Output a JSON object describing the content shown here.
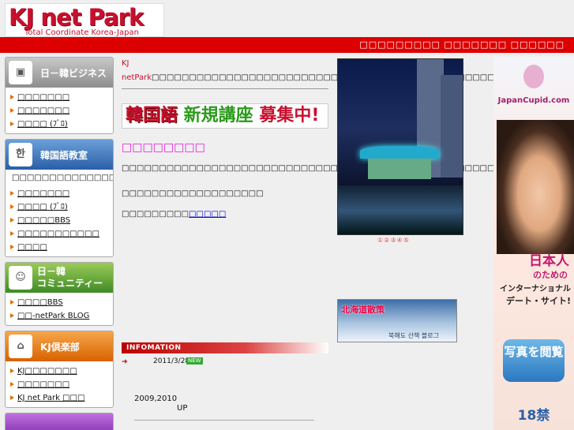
{
  "logo": {
    "title": "KJ net Park",
    "subtitle": "Total Coordinate Korea-Japan"
  },
  "header": {
    "nav_text": "□□□□□□□□□ □□□□□□□ □□□□□□"
  },
  "sidebar": {
    "business": {
      "icon": "computer-icon",
      "title": "日－韓ビジネス",
      "items": [
        "□□□□□□□",
        "□□□□□□□",
        "□□□□ (ﾌﾞﾛ)"
      ]
    },
    "korean": {
      "icon": "book-icon",
      "title": "韓国語教室",
      "intro": "□□□□□□□□□□□□□□□□□□□□□□□□",
      "items": [
        "□□□□□□□",
        "□□□□ (ﾌﾞﾛ)",
        "□□□□□BBS",
        "□□□□□□□□□□□",
        "□□□□"
      ]
    },
    "community": {
      "icon": "people-icon",
      "title_line1": "日－韓",
      "title_line2": "コミュニティー",
      "items": [
        "□□□□BBS",
        "□□-netPark BLOG"
      ]
    },
    "club": {
      "icon": "house-icon",
      "title": "KJ倶楽部",
      "items": [
        "KJ□□□□□□□",
        "□□□□□□□",
        "KJ net Park □□□"
      ]
    }
  },
  "main": {
    "intro_brand": "KJ netPark",
    "intro_rest": "□□□□□□□□□□□□□□□□□□□□□□□□□□□□□□□□□□□□□□□□□□□□□□□□□□□□□□□Park□□□□□□□□□□□□□□□□□□□□□□□□□□□□□□□□□□□□□□□□□□□□□□□□□□□□□□□□□□□□□",
    "banner": {
      "part1": "韓国語",
      "part2": " 新規講座 ",
      "part3": "募集中!"
    },
    "lesson_title": "□□□□□□□□",
    "lesson_text": "□□□□□□□□□□□□□□□□□□□□□□□□□□□□□□□□□□□□□□□□□□□□□□□□□□□□□□□□□□□□□□□□",
    "contact": "□□□□□□□□□□□□□□□□□□□",
    "more_prefix": "□□□□□□□□□",
    "more_link": "□□□□□"
  },
  "info": {
    "header": "INFOMATION",
    "date": "2011/3/28",
    "new_badge": "NEW",
    "years": "2009,2010",
    "up": "UP"
  },
  "photo_dots": "①②③④⑤",
  "hokkaido": {
    "title": "北海道散策",
    "caption": "북해도 산책 블로그"
  },
  "cupid": {
    "logo": "JapanCupid.com",
    "line1": "日本人",
    "line2": "のための",
    "line3": "インターナショナル",
    "line4": "デート・サイト!",
    "button": "写真を閲覧",
    "age": "18禁"
  }
}
